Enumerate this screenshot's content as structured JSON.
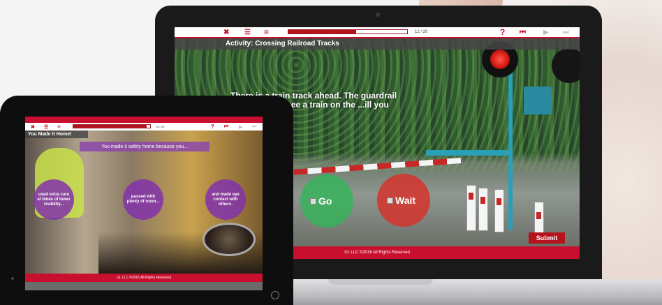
{
  "laptop": {
    "toolbar": {
      "close_icon": "✖",
      "menu_icon": "☰",
      "list_icon": "≡",
      "progress_fraction": 0.57,
      "page_counter": "12 / 20",
      "help_icon": "?",
      "rewind_icon": "⏮",
      "play_icon": "▶",
      "skip_icon": "⏭"
    },
    "activity_title": "Activity: Crossing Railroad Tracks",
    "question": "There is a train track ahead. The guardrail is... you don't see a train on the ...ill you do?",
    "choices": [
      {
        "label": "Go",
        "color": "#34b45a"
      },
      {
        "label": "Wait",
        "color": "#d63028"
      }
    ],
    "submit_label": "Submit",
    "footer": "UL LLC ©2016 All Rights Reserved"
  },
  "tablet": {
    "toolbar": {
      "close_icon": "✖",
      "menu_icon": "☰",
      "list_icon": "≡",
      "progress_fraction": 0.95,
      "page_counter": "19 / 20",
      "help_icon": "?",
      "rewind_icon": "⏮",
      "play_icon": "▶",
      "skip_icon": "⏭"
    },
    "heading": "You Made It Home!",
    "prompt": "You made it safely home because you...",
    "bubbles": [
      "used extra care at times of lower visibility...",
      "passed with plenty of room...",
      "and made eye contact with others."
    ],
    "footer": "UL LLC ©2016 All Rights Reserved"
  },
  "colors": {
    "brand_red": "#c8102e",
    "purple": "#8232aa"
  }
}
